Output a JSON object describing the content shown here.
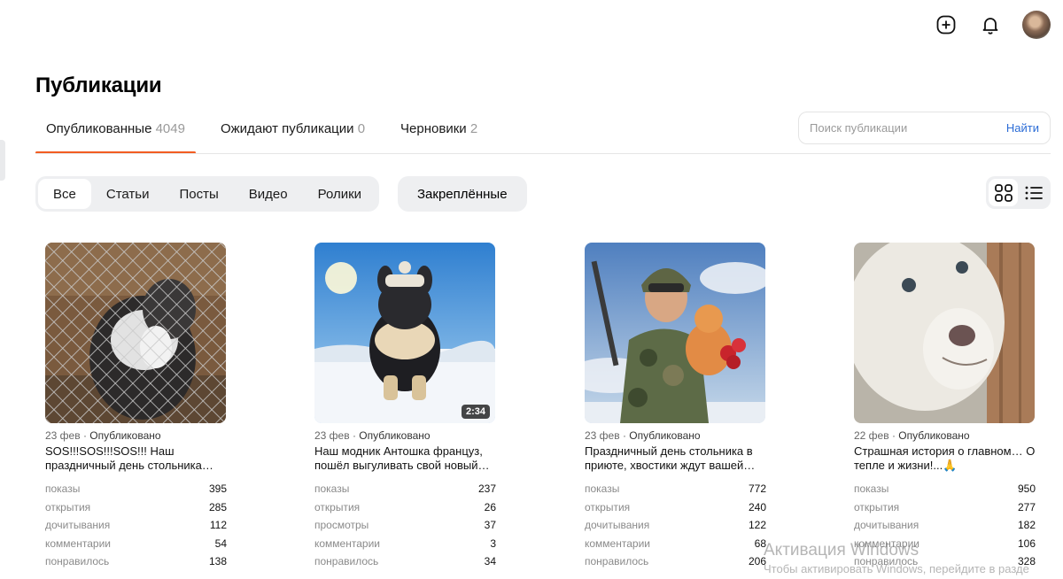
{
  "header": {
    "add_icon": "plus-circle-icon",
    "bell_icon": "bell-icon"
  },
  "page": {
    "title": "Публикации"
  },
  "tabs": [
    {
      "label": "Опубликованные",
      "count": "4049"
    },
    {
      "label": "Ожидают публикации",
      "count": "0"
    },
    {
      "label": "Черновики",
      "count": "2"
    }
  ],
  "search": {
    "placeholder": "Поиск публикации",
    "button": "Найти"
  },
  "filters": {
    "chips": [
      "Все",
      "Статьи",
      "Посты",
      "Видео",
      "Ролики"
    ],
    "pinned": "Закреплённые"
  },
  "view": {
    "grid_icon": "grid-view-icon",
    "list_icon": "list-view-icon"
  },
  "cards": [
    {
      "date": "23 фев",
      "status": "Опубликовано",
      "title": "SOS!!!SOS!!!SOS!!! Наш праздничный день стольника провалился!!!",
      "duration": "",
      "stats": [
        {
          "label": "показы",
          "value": "395"
        },
        {
          "label": "открытия",
          "value": "285"
        },
        {
          "label": "дочитывания",
          "value": "112"
        },
        {
          "label": "комментарии",
          "value": "54"
        },
        {
          "label": "понравилось",
          "value": "138"
        }
      ]
    },
    {
      "date": "23 фев",
      "status": "Опубликовано",
      "title": "Наш модник Антошка француз, пошёл выгуливать свой новый комбинезон",
      "duration": "2:34",
      "stats": [
        {
          "label": "показы",
          "value": "237"
        },
        {
          "label": "открытия",
          "value": "26"
        },
        {
          "label": "просмотры",
          "value": "37"
        },
        {
          "label": "комментарии",
          "value": "3"
        },
        {
          "label": "понравилось",
          "value": "34"
        }
      ]
    },
    {
      "date": "23 фев",
      "status": "Опубликовано",
      "title": "Праздничный день стольника в приюте, хвостики ждут вашей помощи",
      "duration": "",
      "stats": [
        {
          "label": "показы",
          "value": "772"
        },
        {
          "label": "открытия",
          "value": "240"
        },
        {
          "label": "дочитывания",
          "value": "122"
        },
        {
          "label": "комментарии",
          "value": "68"
        },
        {
          "label": "понравилось",
          "value": "206"
        }
      ]
    },
    {
      "date": "22 фев",
      "status": "Опубликовано",
      "title": "Страшная история о главном… О тепле и жизни!...🙏",
      "duration": "",
      "stats": [
        {
          "label": "показы",
          "value": "950"
        },
        {
          "label": "открытия",
          "value": "277"
        },
        {
          "label": "дочитывания",
          "value": "182"
        },
        {
          "label": "комментарии",
          "value": "106"
        },
        {
          "label": "понравилось",
          "value": "328"
        }
      ]
    }
  ],
  "watermark": {
    "line1": "Активация Windows",
    "line2": "Чтобы активировать Windows, перейдите в разде"
  }
}
